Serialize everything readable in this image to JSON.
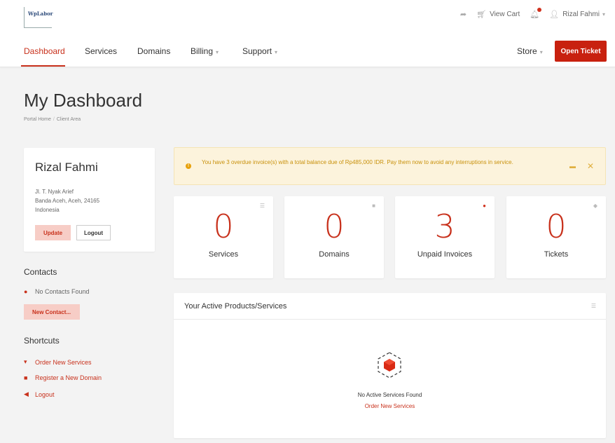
{
  "brand": {
    "logo_text": "WpLabor"
  },
  "topbar": {
    "view_cart": "View Cart",
    "user_name": "Rizal Fahmi"
  },
  "nav": {
    "items": [
      "Dashboard",
      "Services",
      "Domains",
      "Billing",
      "Support"
    ],
    "store": "Store",
    "open_ticket": "Open Ticket"
  },
  "page": {
    "title": "My Dashboard",
    "breadcrumb": [
      "Portal Home",
      "Client Area"
    ]
  },
  "profile": {
    "name": "Rizal Fahmi",
    "address_line1": "Jl. T. Nyak Arief",
    "address_line2": "Banda Aceh, Aceh, 24165",
    "address_line3": "Indonesia",
    "update_label": "Update",
    "logout_label": "Logout"
  },
  "contacts": {
    "title": "Contacts",
    "empty": "No Contacts Found",
    "new_button": "New Contact..."
  },
  "shortcuts": {
    "title": "Shortcuts",
    "items": [
      "Order New Services",
      "Register a New Domain",
      "Logout"
    ]
  },
  "alert": {
    "message": "You have 3 overdue invoice(s) with a total balance due of Rp485,000 IDR. Pay them now to avoid any interruptions in service."
  },
  "stats": [
    {
      "value": "0",
      "label": "Services"
    },
    {
      "value": "0",
      "label": "Domains"
    },
    {
      "value": "3",
      "label": "Unpaid Invoices"
    },
    {
      "value": "0",
      "label": "Tickets"
    }
  ],
  "products": {
    "title": "Your Active Products/Services",
    "empty": "No Active Services Found",
    "order_link": "Order New Services"
  },
  "colors": {
    "accent": "#c8311c",
    "alert_bg": "#fcf3dc",
    "alert_text": "#c8900a"
  }
}
